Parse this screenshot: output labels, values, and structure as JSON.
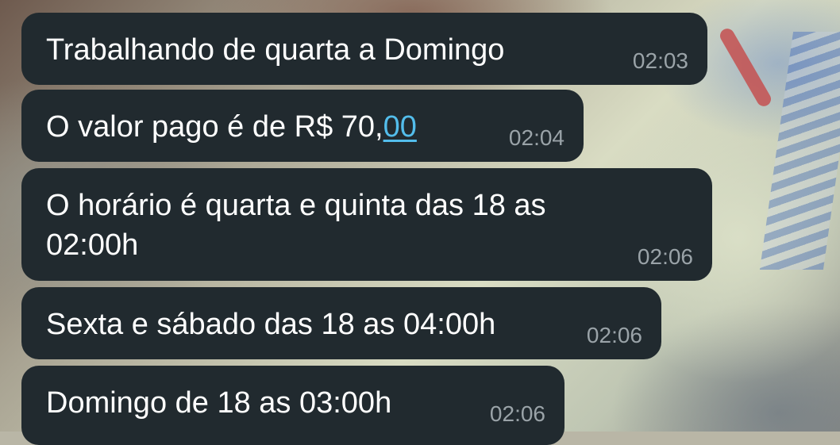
{
  "messages": [
    {
      "text": "Trabalhando de quarta a  Domingo",
      "time": "02:03"
    },
    {
      "text_before_link": "O valor pago é de R$ 70,",
      "link_text": "00",
      "time": "02:04"
    },
    {
      "line1": "O horário é quarta e quinta das 18 as",
      "line2": "02:00h",
      "time": "02:06"
    },
    {
      "text": "Sexta e sábado das 18 as 04:00h",
      "time": "02:06"
    },
    {
      "text": "Domingo de 18 as 03:00h",
      "time": "02:06"
    }
  ],
  "colors": {
    "bubble": "#212a2f",
    "text": "#ffffff",
    "timestamp": "#9aa3a8",
    "link": "#53bdeb"
  }
}
